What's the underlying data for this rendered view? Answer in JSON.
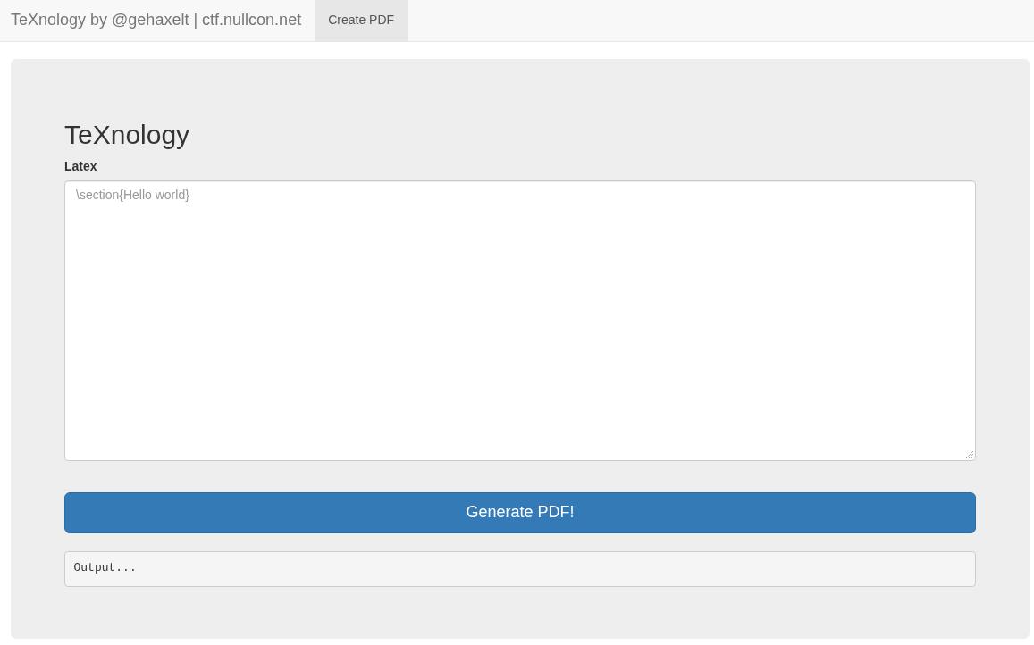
{
  "navbar": {
    "brand": "TeXnology by @gehaxelt | ctf.nullcon.net",
    "items": [
      {
        "label": "Create PDF",
        "selected": true
      }
    ]
  },
  "main": {
    "heading": "TeXnology",
    "field_label": "Latex",
    "latex_field": {
      "placeholder": "\\section{Hello world}"
    },
    "submit_button": "Generate PDF!",
    "output": "Output..."
  }
}
